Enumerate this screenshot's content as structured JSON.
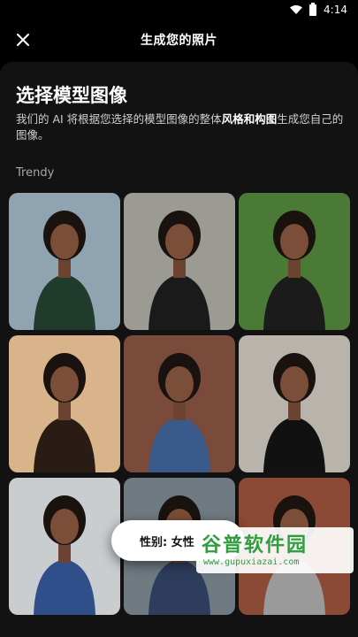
{
  "status_bar": {
    "time": "4:14"
  },
  "app_bar": {
    "title": "生成您的照片"
  },
  "content": {
    "heading": "选择模型图像",
    "description_part1": "我们的 AI 将根据您选择的模型图像的整体",
    "description_emphasis": "风格和构图",
    "description_part2": "生成您自己的图像。",
    "section_label": "Trendy"
  },
  "gender_pill": {
    "label": "性别: 女性"
  },
  "watermark": {
    "title": "谷普软件园",
    "url": "www.gupuxiazai.com"
  },
  "tiles": [
    {
      "name": "model-tile-1",
      "bg": "#8fa3b0",
      "fg": "#1e3b2c"
    },
    {
      "name": "model-tile-2",
      "bg": "#9b9a93",
      "fg": "#1a1a1a"
    },
    {
      "name": "model-tile-3",
      "bg": "#4b7a36",
      "fg": "#1b1b1b"
    },
    {
      "name": "model-tile-4",
      "bg": "#d9b38a",
      "fg": "#2a1c14"
    },
    {
      "name": "model-tile-5",
      "bg": "#7a4a3a",
      "fg": "#3a5a8c"
    },
    {
      "name": "model-tile-6",
      "bg": "#b8b4ac",
      "fg": "#111111"
    },
    {
      "name": "model-tile-7",
      "bg": "#c9cdd0",
      "fg": "#2f4e8a"
    },
    {
      "name": "model-tile-8",
      "bg": "#6f7a82",
      "fg": "#2e3d5c"
    },
    {
      "name": "model-tile-9",
      "bg": "#8a4a35",
      "fg": "#9a9a9a"
    }
  ]
}
